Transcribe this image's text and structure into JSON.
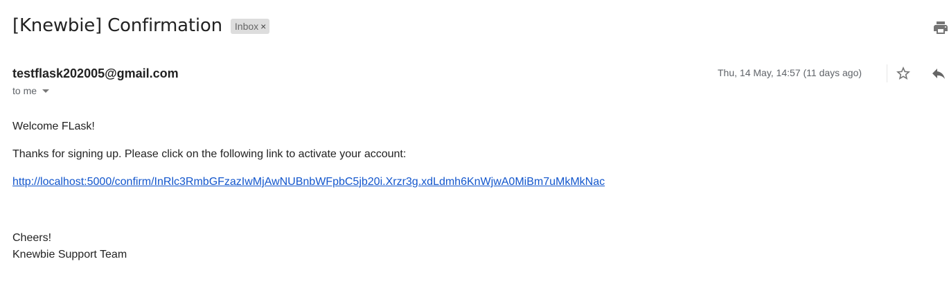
{
  "email": {
    "subject": "[Knewbie] Confirmation",
    "label": "Inbox",
    "label_remove_glyph": "×",
    "sender": "testflask202005@gmail.com",
    "recipient": "to me",
    "date": "Thu, 14 May, 14:57 (11 days ago)",
    "body": {
      "greeting": "Welcome FLask!",
      "instruction": "Thanks for signing up. Please click on the following link to activate your account:",
      "link": "http://localhost:5000/confirm/InRlc3RmbGFzazIwMjAwNUBnbWFpbC5jb20i.Xrzr3g.xdLdmh6KnWjwA0MiBm7uMkMkNac",
      "signoff": "Cheers!",
      "signature": "Knewbie Support Team"
    }
  },
  "icons": {
    "print": "print-icon",
    "star": "star-outline-icon",
    "reply": "reply-icon",
    "recipient_details": "caret-down-icon"
  },
  "colors": {
    "link": "#1155cc",
    "muted_text": "#5f6368",
    "label_chip_bg": "#dddddd",
    "icon_gray": "#757575"
  }
}
